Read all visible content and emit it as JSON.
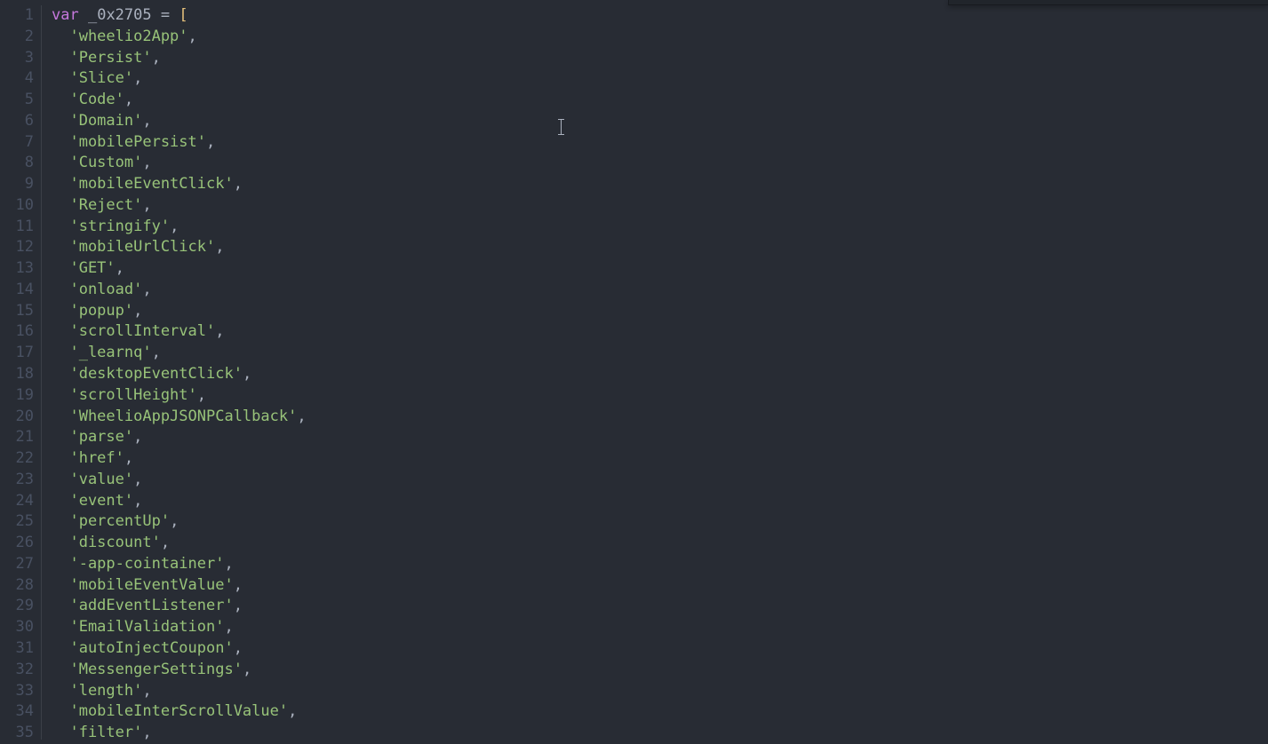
{
  "editor": {
    "var_keyword": "var",
    "identifier": "_0x2705",
    "equals": "=",
    "open_bracket": "[",
    "cursor_line": 6,
    "lines": [
      {
        "num": 1
      },
      {
        "num": 2,
        "str": "'wheelio2App'",
        "comma": ","
      },
      {
        "num": 3,
        "str": "'Persist'",
        "comma": ","
      },
      {
        "num": 4,
        "str": "'Slice'",
        "comma": ","
      },
      {
        "num": 5,
        "str": "'Code'",
        "comma": ","
      },
      {
        "num": 6,
        "str": "'Domain'",
        "comma": ","
      },
      {
        "num": 7,
        "str": "'mobilePersist'",
        "comma": ","
      },
      {
        "num": 8,
        "str": "'Custom'",
        "comma": ","
      },
      {
        "num": 9,
        "str": "'mobileEventClick'",
        "comma": ","
      },
      {
        "num": 10,
        "str": "'Reject'",
        "comma": ","
      },
      {
        "num": 11,
        "str": "'stringify'",
        "comma": ","
      },
      {
        "num": 12,
        "str": "'mobileUrlClick'",
        "comma": ","
      },
      {
        "num": 13,
        "str": "'GET'",
        "comma": ","
      },
      {
        "num": 14,
        "str": "'onload'",
        "comma": ","
      },
      {
        "num": 15,
        "str": "'popup'",
        "comma": ","
      },
      {
        "num": 16,
        "str": "'scrollInterval'",
        "comma": ","
      },
      {
        "num": 17,
        "str": "'_learnq'",
        "comma": ","
      },
      {
        "num": 18,
        "str": "'desktopEventClick'",
        "comma": ","
      },
      {
        "num": 19,
        "str": "'scrollHeight'",
        "comma": ","
      },
      {
        "num": 20,
        "str": "'WheelioAppJSONPCallback'",
        "comma": ","
      },
      {
        "num": 21,
        "str": "'parse'",
        "comma": ","
      },
      {
        "num": 22,
        "str": "'href'",
        "comma": ","
      },
      {
        "num": 23,
        "str": "'value'",
        "comma": ","
      },
      {
        "num": 24,
        "str": "'event'",
        "comma": ","
      },
      {
        "num": 25,
        "str": "'percentUp'",
        "comma": ","
      },
      {
        "num": 26,
        "str": "'discount'",
        "comma": ","
      },
      {
        "num": 27,
        "str": "'-app-cointainer'",
        "comma": ","
      },
      {
        "num": 28,
        "str": "'mobileEventValue'",
        "comma": ","
      },
      {
        "num": 29,
        "str": "'addEventListener'",
        "comma": ","
      },
      {
        "num": 30,
        "str": "'EmailValidation'",
        "comma": ","
      },
      {
        "num": 31,
        "str": "'autoInjectCoupon'",
        "comma": ","
      },
      {
        "num": 32,
        "str": "'MessengerSettings'",
        "comma": ","
      },
      {
        "num": 33,
        "str": "'length'",
        "comma": ","
      },
      {
        "num": 34,
        "str": "'mobileInterScrollValue'",
        "comma": ","
      },
      {
        "num": 35,
        "str": "'filter'",
        "comma": ","
      }
    ]
  }
}
